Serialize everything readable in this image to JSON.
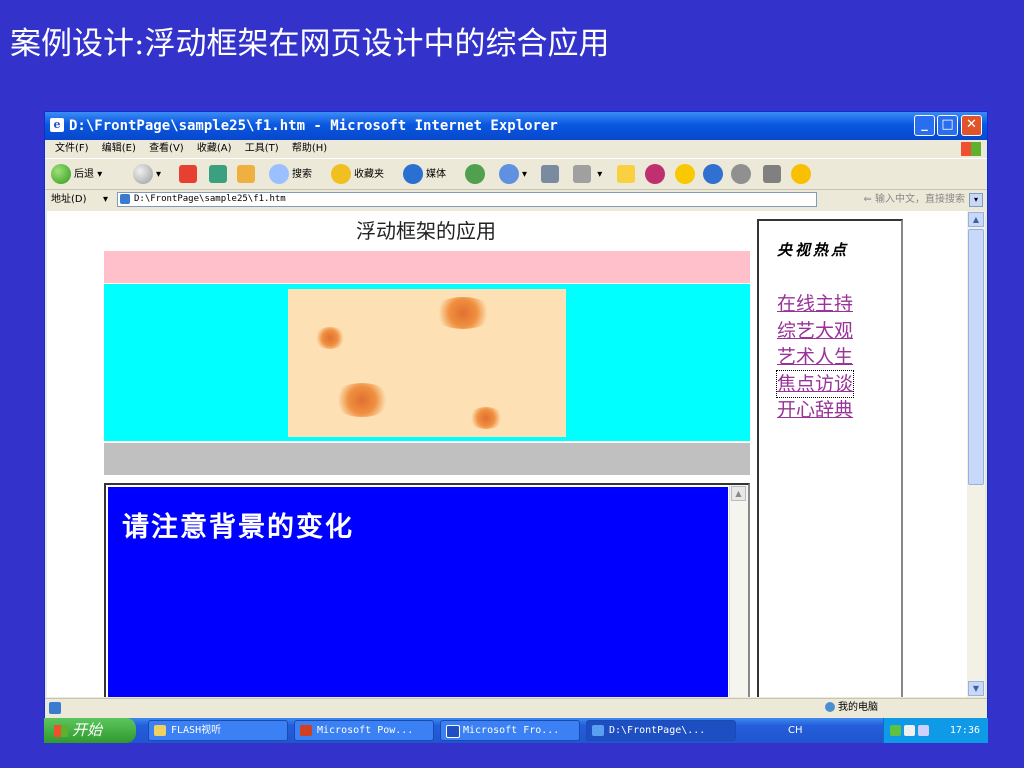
{
  "slide": {
    "title": "案例设计:浮动框架在网页设计中的综合应用"
  },
  "window": {
    "title": "D:\\FrontPage\\sample25\\f1.htm - Microsoft Internet Explorer",
    "min_glyph": "_",
    "max_glyph": "□",
    "close_glyph": "✕"
  },
  "menu": [
    "文件(F)",
    "编辑(E)",
    "查看(V)",
    "收藏(A)",
    "工具(T)",
    "帮助(H)"
  ],
  "toolbar": {
    "back_label": "后退",
    "search_label": "搜索",
    "favorites_label": "收藏夹",
    "media_label": "媒体",
    "dropdown_glyph": "▾"
  },
  "address": {
    "label": "地址(D)",
    "url": "D:\\FrontPage\\sample25\\f1.htm",
    "search_hint": "输入中文，直接搜索",
    "search_arrow": "⇐",
    "dropdown_glyph": "▾"
  },
  "page": {
    "heading": "浮动框架的应用",
    "iframe_text": "请注意背景的变化",
    "side_title": "央视热点",
    "side_links": [
      "在线主持",
      "综艺大观",
      "艺术人生",
      "焦点访谈",
      "开心辞典"
    ]
  },
  "scroll": {
    "up_glyph": "▲",
    "down_glyph": "▼"
  },
  "status": {
    "zone": "我的电脑"
  },
  "taskbar": {
    "start_label": "开始",
    "tasks": [
      "FLASH视听",
      "Microsoft Pow...",
      "Microsoft Fro...",
      "D:\\FrontPage\\..."
    ],
    "lang": "CH",
    "clock": "17:36"
  },
  "colors": {
    "slide_bg": "#3333cc",
    "pink_band": "#ffc0cb",
    "cyan_band": "#00ffff",
    "gray_band": "#c0c0c0",
    "iframe_bg": "#0000ff",
    "link_color": "#993399"
  }
}
